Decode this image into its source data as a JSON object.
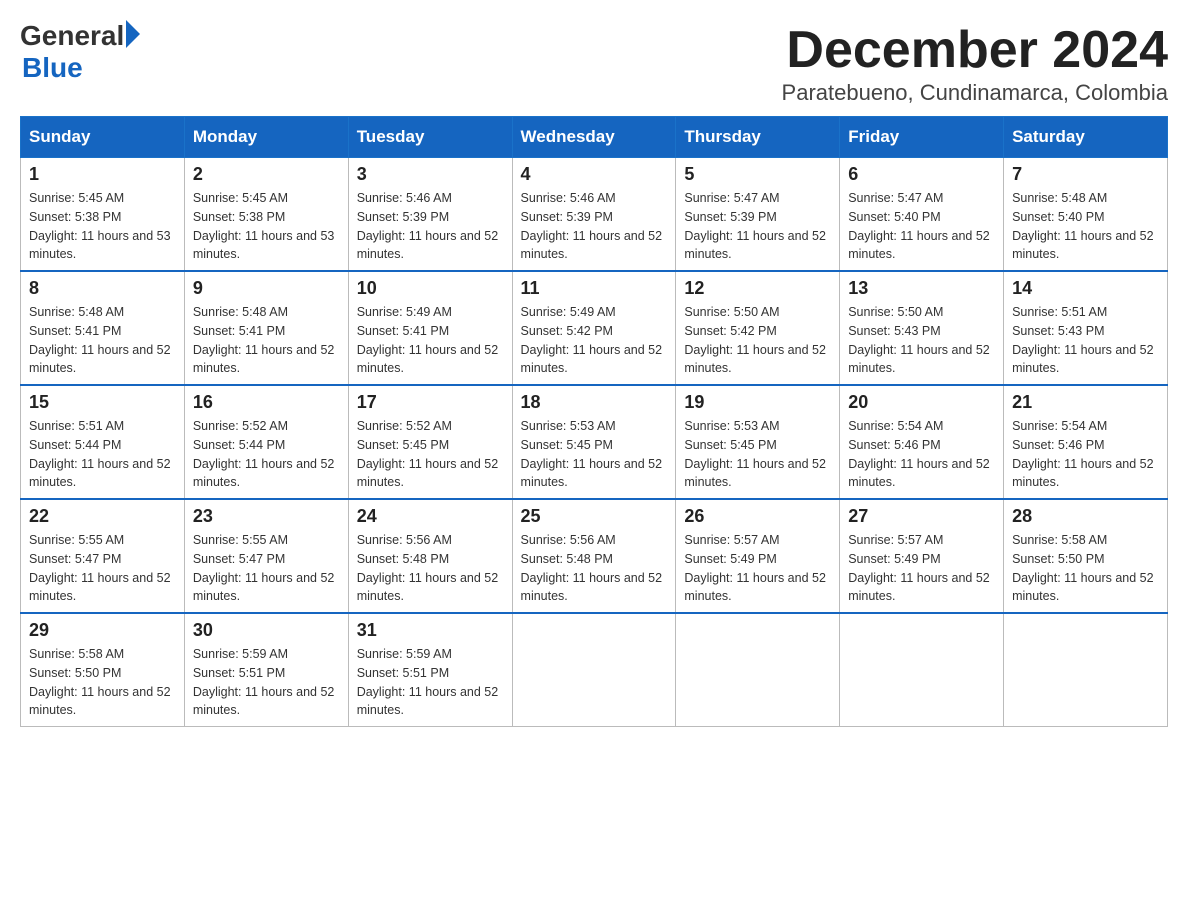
{
  "header": {
    "logo_general": "General",
    "logo_blue": "Blue",
    "month_title": "December 2024",
    "location": "Paratebueno, Cundinamarca, Colombia"
  },
  "weekdays": [
    "Sunday",
    "Monday",
    "Tuesday",
    "Wednesday",
    "Thursday",
    "Friday",
    "Saturday"
  ],
  "weeks": [
    [
      {
        "day": "1",
        "sunrise": "5:45 AM",
        "sunset": "5:38 PM",
        "daylight": "11 hours and 53 minutes."
      },
      {
        "day": "2",
        "sunrise": "5:45 AM",
        "sunset": "5:38 PM",
        "daylight": "11 hours and 53 minutes."
      },
      {
        "day": "3",
        "sunrise": "5:46 AM",
        "sunset": "5:39 PM",
        "daylight": "11 hours and 52 minutes."
      },
      {
        "day": "4",
        "sunrise": "5:46 AM",
        "sunset": "5:39 PM",
        "daylight": "11 hours and 52 minutes."
      },
      {
        "day": "5",
        "sunrise": "5:47 AM",
        "sunset": "5:39 PM",
        "daylight": "11 hours and 52 minutes."
      },
      {
        "day": "6",
        "sunrise": "5:47 AM",
        "sunset": "5:40 PM",
        "daylight": "11 hours and 52 minutes."
      },
      {
        "day": "7",
        "sunrise": "5:48 AM",
        "sunset": "5:40 PM",
        "daylight": "11 hours and 52 minutes."
      }
    ],
    [
      {
        "day": "8",
        "sunrise": "5:48 AM",
        "sunset": "5:41 PM",
        "daylight": "11 hours and 52 minutes."
      },
      {
        "day": "9",
        "sunrise": "5:48 AM",
        "sunset": "5:41 PM",
        "daylight": "11 hours and 52 minutes."
      },
      {
        "day": "10",
        "sunrise": "5:49 AM",
        "sunset": "5:41 PM",
        "daylight": "11 hours and 52 minutes."
      },
      {
        "day": "11",
        "sunrise": "5:49 AM",
        "sunset": "5:42 PM",
        "daylight": "11 hours and 52 minutes."
      },
      {
        "day": "12",
        "sunrise": "5:50 AM",
        "sunset": "5:42 PM",
        "daylight": "11 hours and 52 minutes."
      },
      {
        "day": "13",
        "sunrise": "5:50 AM",
        "sunset": "5:43 PM",
        "daylight": "11 hours and 52 minutes."
      },
      {
        "day": "14",
        "sunrise": "5:51 AM",
        "sunset": "5:43 PM",
        "daylight": "11 hours and 52 minutes."
      }
    ],
    [
      {
        "day": "15",
        "sunrise": "5:51 AM",
        "sunset": "5:44 PM",
        "daylight": "11 hours and 52 minutes."
      },
      {
        "day": "16",
        "sunrise": "5:52 AM",
        "sunset": "5:44 PM",
        "daylight": "11 hours and 52 minutes."
      },
      {
        "day": "17",
        "sunrise": "5:52 AM",
        "sunset": "5:45 PM",
        "daylight": "11 hours and 52 minutes."
      },
      {
        "day": "18",
        "sunrise": "5:53 AM",
        "sunset": "5:45 PM",
        "daylight": "11 hours and 52 minutes."
      },
      {
        "day": "19",
        "sunrise": "5:53 AM",
        "sunset": "5:45 PM",
        "daylight": "11 hours and 52 minutes."
      },
      {
        "day": "20",
        "sunrise": "5:54 AM",
        "sunset": "5:46 PM",
        "daylight": "11 hours and 52 minutes."
      },
      {
        "day": "21",
        "sunrise": "5:54 AM",
        "sunset": "5:46 PM",
        "daylight": "11 hours and 52 minutes."
      }
    ],
    [
      {
        "day": "22",
        "sunrise": "5:55 AM",
        "sunset": "5:47 PM",
        "daylight": "11 hours and 52 minutes."
      },
      {
        "day": "23",
        "sunrise": "5:55 AM",
        "sunset": "5:47 PM",
        "daylight": "11 hours and 52 minutes."
      },
      {
        "day": "24",
        "sunrise": "5:56 AM",
        "sunset": "5:48 PM",
        "daylight": "11 hours and 52 minutes."
      },
      {
        "day": "25",
        "sunrise": "5:56 AM",
        "sunset": "5:48 PM",
        "daylight": "11 hours and 52 minutes."
      },
      {
        "day": "26",
        "sunrise": "5:57 AM",
        "sunset": "5:49 PM",
        "daylight": "11 hours and 52 minutes."
      },
      {
        "day": "27",
        "sunrise": "5:57 AM",
        "sunset": "5:49 PM",
        "daylight": "11 hours and 52 minutes."
      },
      {
        "day": "28",
        "sunrise": "5:58 AM",
        "sunset": "5:50 PM",
        "daylight": "11 hours and 52 minutes."
      }
    ],
    [
      {
        "day": "29",
        "sunrise": "5:58 AM",
        "sunset": "5:50 PM",
        "daylight": "11 hours and 52 minutes."
      },
      {
        "day": "30",
        "sunrise": "5:59 AM",
        "sunset": "5:51 PM",
        "daylight": "11 hours and 52 minutes."
      },
      {
        "day": "31",
        "sunrise": "5:59 AM",
        "sunset": "5:51 PM",
        "daylight": "11 hours and 52 minutes."
      },
      null,
      null,
      null,
      null
    ]
  ]
}
